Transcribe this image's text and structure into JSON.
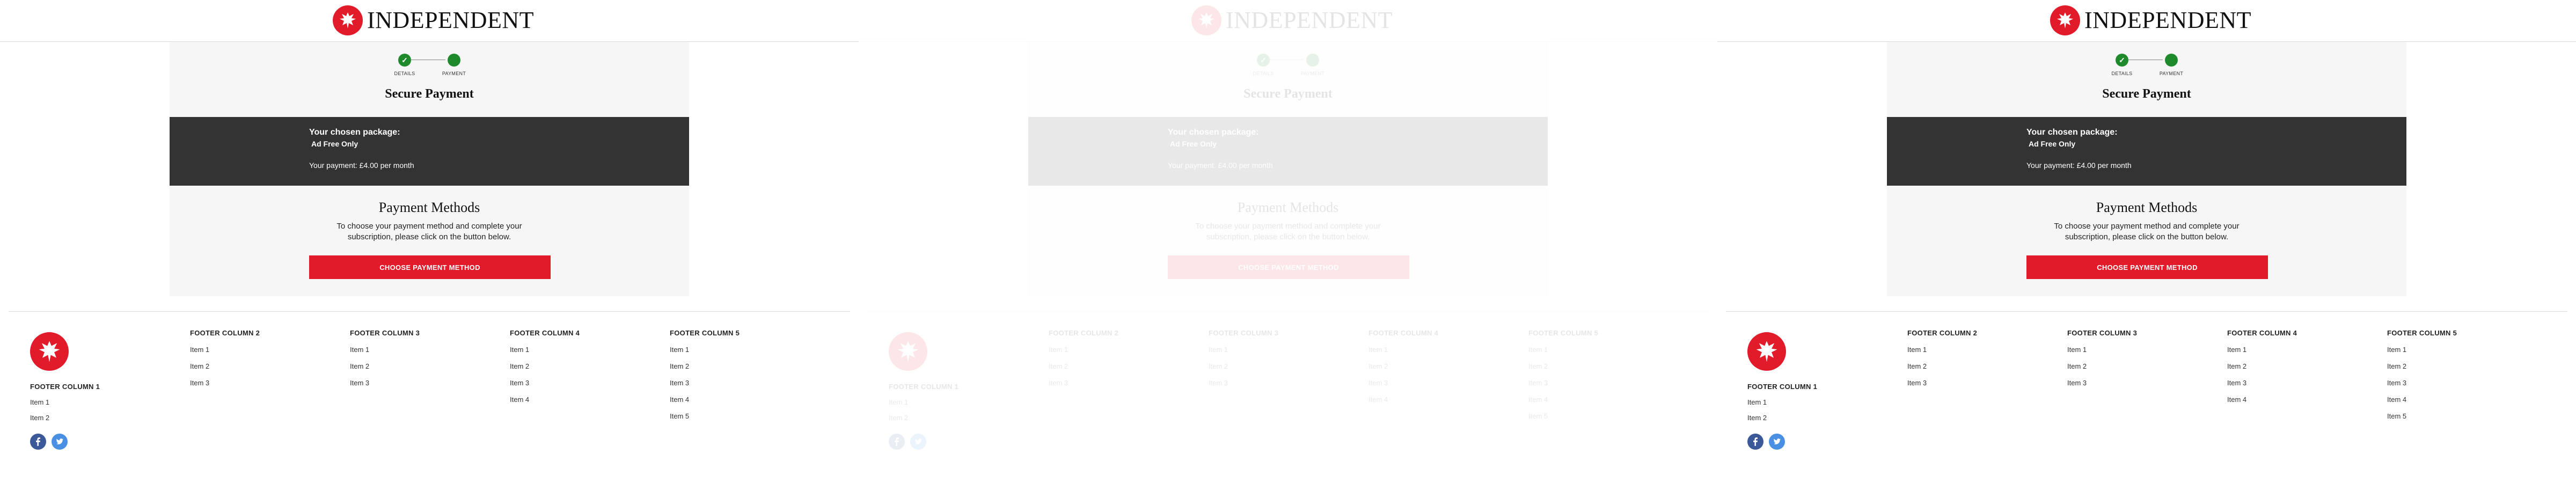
{
  "header": {
    "wordmark": "INDEPENDENT",
    "logo_icon": "eagle-icon"
  },
  "checkout": {
    "steps": [
      {
        "label": "DETAILS",
        "state": "complete"
      },
      {
        "label": "PAYMENT",
        "state": "current"
      }
    ],
    "step_check": "✓",
    "title": "Secure Payment",
    "package": {
      "heading": "Your chosen package:",
      "name": "Ad Free Only",
      "payment": "Your payment: £4.00 per month"
    },
    "methods": {
      "title": "Payment Methods",
      "description": "To choose your payment method and complete your subscription, please click on the button below.",
      "button_label": "CHOOSE PAYMENT METHOD"
    }
  },
  "footer": {
    "columns": [
      {
        "heading": "FOOTER COLUMN 1",
        "items": [
          "Item 1",
          "Item 2"
        ]
      },
      {
        "heading": "FOOTER COLUMN 2",
        "items": [
          "Item 1",
          "Item 2",
          "Item 3"
        ]
      },
      {
        "heading": "FOOTER COLUMN 3",
        "items": [
          "Item 1",
          "Item 2",
          "Item 3"
        ]
      },
      {
        "heading": "FOOTER COLUMN 4",
        "items": [
          "Item 1",
          "Item 2",
          "Item 3",
          "Item 4"
        ]
      },
      {
        "heading": "FOOTER COLUMN 5",
        "items": [
          "Item 1",
          "Item 2",
          "Item 3",
          "Item 4",
          "Item 5"
        ]
      }
    ],
    "social": [
      "facebook-icon",
      "twitter-icon"
    ]
  },
  "colors": {
    "brand_red": "#e21b2a",
    "step_green": "#1e8a2c",
    "package_bg": "#333333",
    "page_bg": "#f6f6f6",
    "facebook": "#3b5998",
    "twitter": "#4a90e2"
  },
  "panels": [
    {
      "state": "normal"
    },
    {
      "state": "faded"
    },
    {
      "state": "normal"
    }
  ]
}
